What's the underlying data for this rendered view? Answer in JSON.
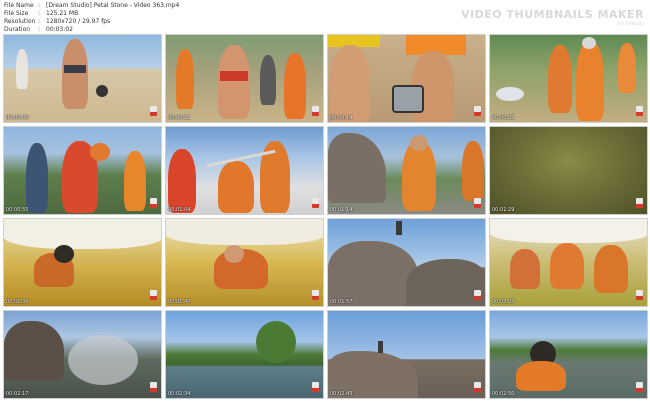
{
  "header": {
    "file_name_label": "File Name",
    "file_name_value": "[Dream Studio] Petal Stone - Video 363.mp4",
    "file_size_label": "File Size",
    "file_size_value": "125.21 MB",
    "resolution_label": "Resolution",
    "resolution_value": "1280x720 / 29.97 fps",
    "duration_label": "Duration",
    "duration_value": "00:03:02",
    "separator": ":"
  },
  "watermark": {
    "title": "VIDEO THUMBNAILS MAKER",
    "subtitle": "by Grandy"
  },
  "thumbnails": [
    {
      "timestamp": "00:00:00"
    },
    {
      "timestamp": "00:00:21"
    },
    {
      "timestamp": "00:00:14"
    },
    {
      "timestamp": "00:00:22"
    },
    {
      "timestamp": "00:00:55"
    },
    {
      "timestamp": "00:01:04"
    },
    {
      "timestamp": "00:01:14"
    },
    {
      "timestamp": "00:01:29"
    },
    {
      "timestamp": "00:01:36"
    },
    {
      "timestamp": "00:01:47"
    },
    {
      "timestamp": "00:01:57"
    },
    {
      "timestamp": "00:02:05"
    },
    {
      "timestamp": "00:02:17"
    },
    {
      "timestamp": "00:02:34"
    },
    {
      "timestamp": "00:02:43"
    },
    {
      "timestamp": "00:02:50"
    }
  ]
}
